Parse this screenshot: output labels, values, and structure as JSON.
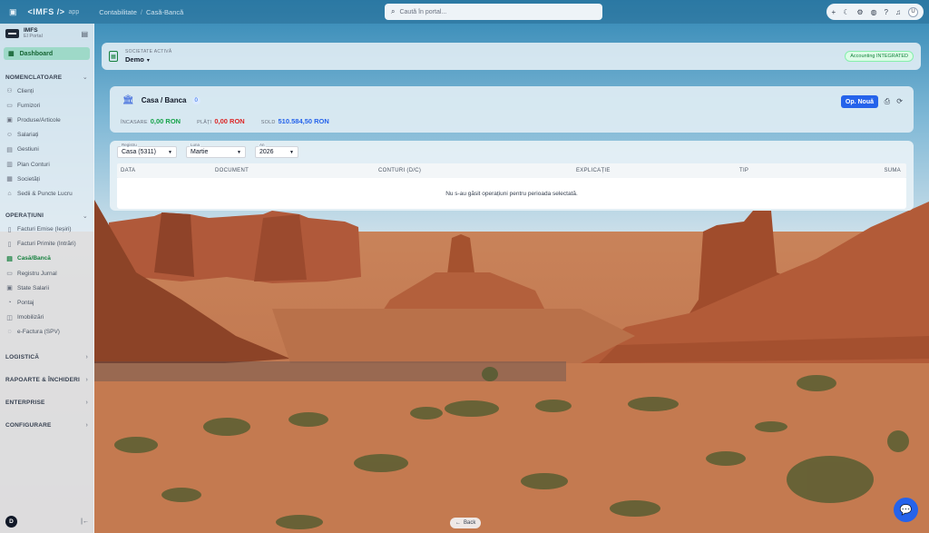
{
  "topbar": {
    "brand": "<IMFS />",
    "brand_sub": "app",
    "breadcrumb": [
      "Contabilitate",
      "Casă-Bancă"
    ],
    "search_placeholder": "Caută în portal..."
  },
  "topbar_icons": [
    "plus-icon",
    "moon-icon",
    "settings-icon",
    "palette-icon",
    "help-icon",
    "bell-icon"
  ],
  "user_initial": "U",
  "sidebar": {
    "app_name": "IMFS",
    "app_sub": "El Portal",
    "dashboard": "Dashboard",
    "sections": [
      {
        "title": "NOMENCLATOARE",
        "items": [
          "Clienți",
          "Furnizori",
          "Produse/Articole",
          "Salariați",
          "Gestiuni",
          "Plan Conturi",
          "Societăți",
          "Sedii & Puncte Lucru"
        ]
      },
      {
        "title": "OPERAȚIUNI",
        "items": [
          "Facturi Emise (Ieșiri)",
          "Facturi Primite (Intrări)",
          "Casă/Bancă",
          "Registru Jurnal",
          "State Salarii",
          "Pontaj",
          "Imobilizări",
          "e-Factura (SPV)"
        ]
      },
      {
        "title": "LOGISTICĂ",
        "items": []
      },
      {
        "title": "RAPOARTE & ÎNCHIDERI",
        "items": []
      },
      {
        "title": "ENTERPRISE",
        "items": []
      },
      {
        "title": "CONFIGURARE",
        "items": []
      }
    ],
    "footer_initial": "D"
  },
  "company": {
    "label": "SOCIETATE ACTIVĂ",
    "value": "Demo",
    "status": "Accounting INTEGRATED"
  },
  "casa": {
    "title": "Casa / Banca",
    "count": "0",
    "stats": [
      {
        "key": "ÎNCASARE",
        "value": "0,00 RON",
        "color": "#16a34a"
      },
      {
        "key": "PLĂȚI",
        "value": "0,00 RON",
        "color": "#dc2626"
      },
      {
        "key": "SOLD",
        "value": "510.584,50 RON",
        "color": "#2563eb"
      }
    ],
    "new_button": "Op. Nouă"
  },
  "filters": [
    {
      "caption": "Registru",
      "value": "Casa (5311)"
    },
    {
      "caption": "Luna",
      "value": "Martie"
    },
    {
      "caption": "An",
      "value": "2026"
    }
  ],
  "table": {
    "columns": [
      "DATA",
      "DOCUMENT",
      "CONTURI (D/C)",
      "EXPLICAȚIE",
      "TIP",
      "SUMA"
    ],
    "empty_message": "Nu s-au găsit operațiuni pentru perioada selectată."
  },
  "back_label": "Back"
}
